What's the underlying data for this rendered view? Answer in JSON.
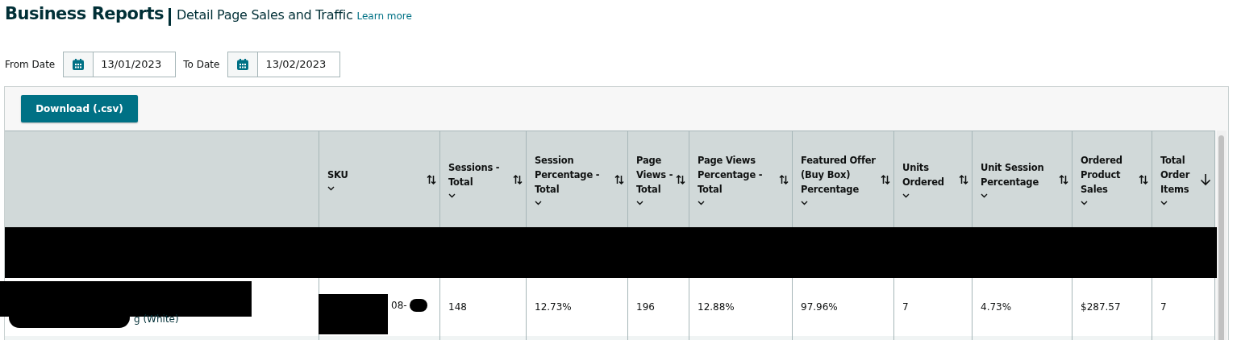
{
  "title": "Business Reports",
  "subtitle": "Detail Page Sales and Traffic",
  "learn_more": "Learn more",
  "dates": [
    {
      "label": "From Date",
      "value": "13/01/2023"
    },
    {
      "label": "To Date",
      "value": "13/02/2023"
    }
  ],
  "download_button": "Download (.csv)",
  "table": {
    "columns": [
      {
        "sortable": false
      },
      {
        "label": "SKU",
        "sortable": true,
        "sorted": false
      },
      {
        "label": "Sessions - Total",
        "sortable": true,
        "sorted": false
      },
      {
        "label": "Session Percentage - Total",
        "sortable": true,
        "sorted": false
      },
      {
        "label": "Page Views - Total",
        "sortable": true,
        "sorted": false
      },
      {
        "label": "Page Views Percentage - Total",
        "sortable": true,
        "sorted": false
      },
      {
        "label": "Featured Offer (Buy Box) Percentage",
        "sortable": true,
        "sorted": false
      },
      {
        "label": "Units Ordered",
        "sortable": true,
        "sorted": false
      },
      {
        "label": "Unit Session Percentage",
        "sortable": true,
        "sorted": false
      },
      {
        "label": "Ordered Product Sales",
        "sortable": true,
        "sorted": false
      },
      {
        "label": "Total Order Items",
        "sortable": true,
        "sorted": true
      }
    ],
    "rows": [
      {
        "kind": "redacted"
      },
      {
        "kind": "data",
        "cells": [
          "g (White)",
          "08-",
          "148",
          "12.73%",
          "196",
          "12.88%",
          "97.96%",
          "7",
          "4.73%",
          "$287.57",
          "7"
        ]
      }
    ]
  }
}
